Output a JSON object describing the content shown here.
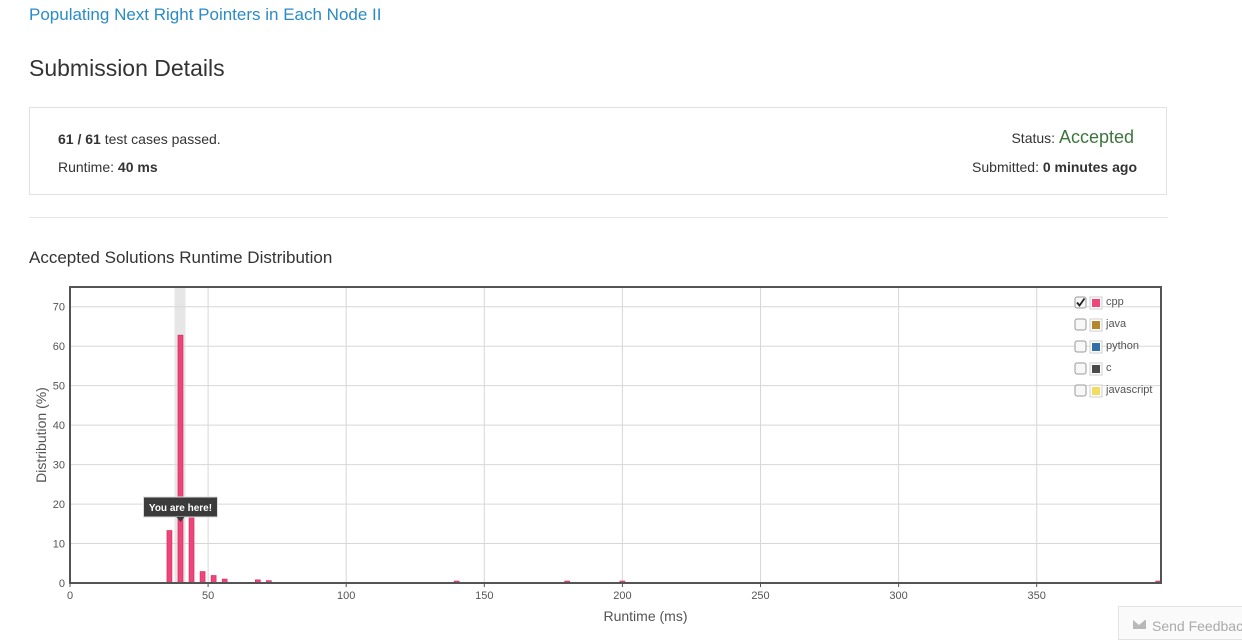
{
  "problem": {
    "title": "Populating Next Right Pointers in Each Node II"
  },
  "page": {
    "title": "Submission Details"
  },
  "summary": {
    "passed": "61",
    "sep": " / ",
    "total": "61",
    "passed_suffix": " test cases passed.",
    "runtime_label": "Runtime: ",
    "runtime_value": "40 ms",
    "status_label": "Status: ",
    "status_value": "Accepted",
    "submitted_label": "Submitted: ",
    "submitted_value": "0 minutes ago"
  },
  "distribution": {
    "title": "Accepted Solutions Runtime Distribution"
  },
  "chart_data": {
    "type": "bar",
    "xlabel": "Runtime (ms)",
    "ylabel": "Distribution (%)",
    "xlim": [
      0,
      395
    ],
    "ylim": [
      0,
      75
    ],
    "xticks": [
      0,
      50,
      100,
      150,
      200,
      250,
      300,
      350
    ],
    "yticks": [
      0,
      10,
      20,
      30,
      40,
      50,
      60,
      70
    ],
    "grid": true,
    "series": [
      {
        "name": "cpp",
        "color": "#f0457a",
        "x": [
          36,
          40,
          44,
          48,
          52,
          56,
          68,
          72,
          140,
          180,
          200,
          394
        ],
        "values": [
          13.3,
          62.8,
          17.5,
          2.9,
          1.9,
          1.0,
          0.8,
          0.6,
          0.5,
          0.5,
          0.5,
          0.5
        ]
      }
    ],
    "highlight": {
      "x": 40,
      "label": "You are here!"
    },
    "legend": {
      "position": "top-right",
      "items": [
        {
          "name": "cpp",
          "color": "#f0457a",
          "checked": true
        },
        {
          "name": "java",
          "color": "#b5862c",
          "checked": false
        },
        {
          "name": "python",
          "color": "#336ea8",
          "checked": false
        },
        {
          "name": "c",
          "color": "#4a4a4a",
          "checked": false
        },
        {
          "name": "javascript",
          "color": "#f2dc61",
          "checked": false
        }
      ]
    }
  },
  "feedback": {
    "label": "Send Feedback"
  }
}
